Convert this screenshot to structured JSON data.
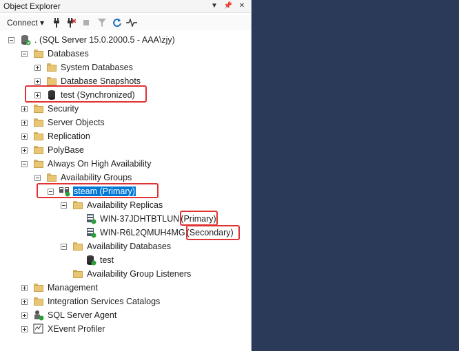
{
  "panel": {
    "title": "Object Explorer",
    "buttons": [
      "▼",
      "📌",
      "✕"
    ]
  },
  "toolbar": {
    "connect_label": "Connect ▾"
  },
  "tree": [
    {
      "id": "root",
      "label": ". (SQL Server 15.0.2000.5 - AAA\\zjy)",
      "level": 0,
      "expander": "minus",
      "icon": "server-icon"
    },
    {
      "id": "databases",
      "label": "Databases",
      "level": 1,
      "expander": "minus",
      "icon": "folder-icon"
    },
    {
      "id": "system-databases",
      "label": "System Databases",
      "level": 2,
      "expander": "plus",
      "icon": "folder-icon"
    },
    {
      "id": "database-snapshots",
      "label": "Database Snapshots",
      "level": 2,
      "expander": "plus",
      "icon": "folder-icon"
    },
    {
      "id": "test-db",
      "label": "test (Synchronized)",
      "level": 2,
      "expander": "plus",
      "icon": "database-icon"
    },
    {
      "id": "security",
      "label": "Security",
      "level": 1,
      "expander": "plus",
      "icon": "folder-icon"
    },
    {
      "id": "server-objects",
      "label": "Server Objects",
      "level": 1,
      "expander": "plus",
      "icon": "folder-icon"
    },
    {
      "id": "replication",
      "label": "Replication",
      "level": 1,
      "expander": "plus",
      "icon": "folder-icon"
    },
    {
      "id": "polybase",
      "label": "PolyBase",
      "level": 1,
      "expander": "plus",
      "icon": "folder-icon"
    },
    {
      "id": "always-on",
      "label": "Always On High Availability",
      "level": 1,
      "expander": "minus",
      "icon": "folder-icon"
    },
    {
      "id": "availability-groups",
      "label": "Availability Groups",
      "level": 2,
      "expander": "minus",
      "icon": "folder-icon"
    },
    {
      "id": "steam-ag",
      "label": "steam (Primary)",
      "level": 3,
      "expander": "minus",
      "icon": "availability-group-icon",
      "selected": true
    },
    {
      "id": "availability-replicas",
      "label": "Availability Replicas",
      "level": 4,
      "expander": "minus",
      "icon": "folder-icon"
    },
    {
      "id": "replica-primary",
      "label": "WIN-37JDHTBTLUN",
      "suffix": "(Primary)",
      "level": 5,
      "expander": "none",
      "icon": "replica-icon"
    },
    {
      "id": "replica-secondary",
      "label": "WIN-R6L2QMUH4MG",
      "suffix": "(Secondary)",
      "level": 5,
      "expander": "none",
      "icon": "replica-icon"
    },
    {
      "id": "availability-databases",
      "label": "Availability Databases",
      "level": 4,
      "expander": "minus",
      "icon": "folder-icon"
    },
    {
      "id": "ag-test-db",
      "label": "test",
      "level": 5,
      "expander": "none",
      "icon": "ag-database-icon"
    },
    {
      "id": "ag-listeners",
      "label": "Availability Group Listeners",
      "level": 4,
      "expander": "none",
      "icon": "folder-icon"
    },
    {
      "id": "management",
      "label": "Management",
      "level": 1,
      "expander": "plus",
      "icon": "folder-icon"
    },
    {
      "id": "integration-services",
      "label": "Integration Services Catalogs",
      "level": 1,
      "expander": "plus",
      "icon": "folder-icon"
    },
    {
      "id": "sql-agent",
      "label": "SQL Server Agent",
      "level": 1,
      "expander": "plus",
      "icon": "agent-icon"
    },
    {
      "id": "xevent-profiler",
      "label": "XEvent Profiler",
      "level": 1,
      "expander": "plus",
      "icon": "profiler-icon"
    }
  ]
}
